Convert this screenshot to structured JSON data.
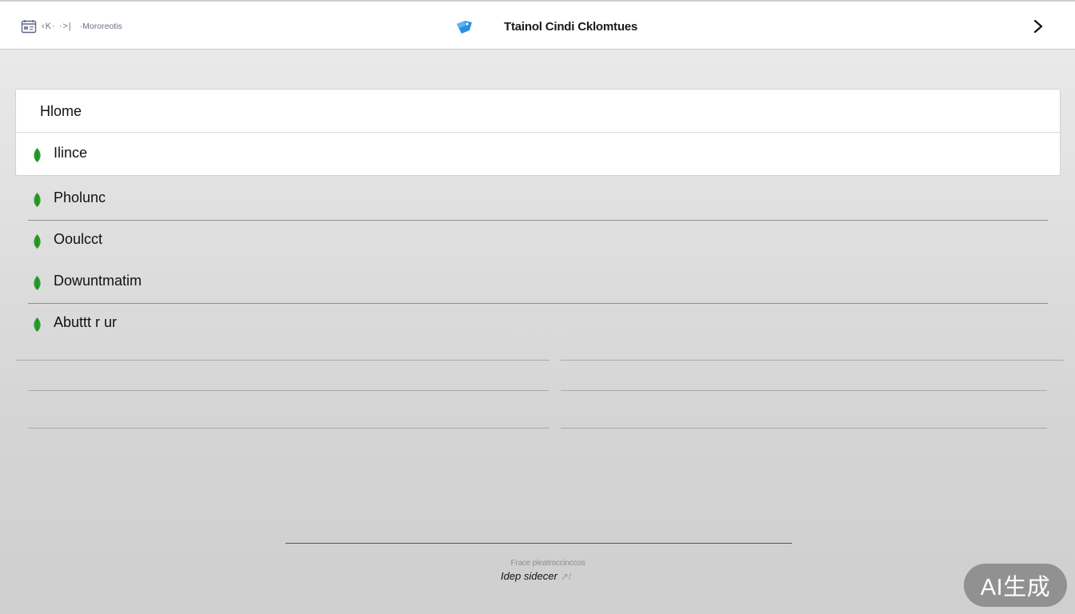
{
  "topbar": {
    "left_nav": "‹K· ·>|",
    "left_label": "·Mororeotis",
    "brand_title": "Ttainol Cindi Cklomtues",
    "right_icon": "chevron-right-icon"
  },
  "menu": {
    "header": "Hlome",
    "items": [
      {
        "label": "Ilince",
        "icon": "leaf-icon"
      },
      {
        "label": "Pholunc",
        "icon": "leaf-icon"
      },
      {
        "label": "Ooulcct",
        "icon": "leaf-icon"
      },
      {
        "label": "Dowuntmatim",
        "icon": "leaf-icon"
      },
      {
        "label": "Abuttt r ur",
        "icon": "leaf-icon"
      }
    ]
  },
  "footer": {
    "small_text": "Frace pleatroccinccos",
    "link_text": "Idep sidecer",
    "link_icon": "↗/"
  },
  "badge": {
    "text": "AI生成"
  },
  "colors": {
    "leaf": "#2a9d2a",
    "brand_icon": "#2b8ee0",
    "background": "#dcdcdc"
  }
}
